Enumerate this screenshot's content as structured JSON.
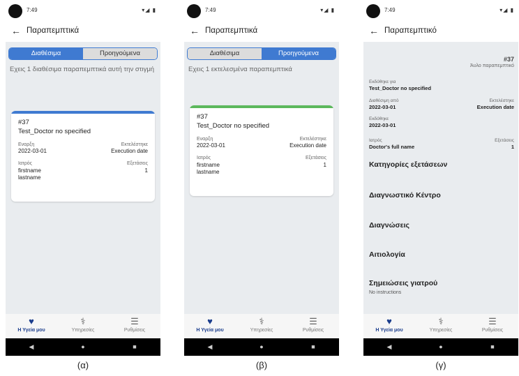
{
  "status": {
    "time": "7:49",
    "indicators": "◉ ▣",
    "signal": "▾◢ ▮"
  },
  "screens": [
    {
      "title": "Παραπεμπτικά",
      "tabs": [
        "Διαθέσιμα",
        "Προηγούμενα"
      ],
      "active_tab": 0,
      "info": "Εχεις 1 διαθέσιμα παραπεμπτικά αυτή την στιγμή",
      "card": {
        "number": "#37",
        "name": "Test_Doctor no specified",
        "start_label": "Εναρξη",
        "start_value": "2022-03-01",
        "executed_label": "Εκτελέστηκε",
        "executed_value": "Execution date",
        "doctor_label": "Ιατρός",
        "doctor_first": "firstname",
        "doctor_last": "lastname",
        "exams_label": "Εξετάσεις",
        "exams_value": "1",
        "accent": "#3f7ad1"
      }
    },
    {
      "title": "Παραπεμπτικά",
      "tabs": [
        "Διαθέσιμα",
        "Προηγούμενα"
      ],
      "active_tab": 1,
      "info": "Εχεις 1 εκτελεσμένα παραπεμπτικά",
      "card": {
        "number": "#37",
        "name": "Test_Doctor no specified",
        "start_label": "Εναρξη",
        "start_value": "2022-03-01",
        "executed_label": "Εκτελέστηκε",
        "executed_value": "Execution date",
        "doctor_label": "Ιατρός",
        "doctor_first": "firstname",
        "doctor_last": "lastname",
        "exams_label": "Εξετάσεις",
        "exams_value": "1",
        "accent": "#5cb85c"
      }
    },
    {
      "title": "Παραπεμπτικό",
      "number": "#37",
      "type": "Άυλο παραπεμπτικό",
      "issued_for_label": "Εκδόθηκε για",
      "issued_for_value": "Test_Doctor no specified",
      "available_from_label": "Διαθέσιμη από",
      "available_from_value": "2022-03-01",
      "executed_label": "Εκτελέστηκε",
      "executed_value": "Execution date",
      "issued_label": "Εκδόθηκε",
      "issued_value": "2022-03-01",
      "doctor_label": "Ιατρός",
      "doctor_value": "Doctor's full name",
      "exams_label": "Εξετάσεις",
      "exams_value": "1",
      "sections": [
        "Κατηγορίες εξετάσεων",
        "Διαγνωστικό Κέντρο",
        "Διαγνώσεις",
        "Αιτιολογία",
        "Σημειώσεις γιατρού"
      ],
      "notes": "No instructions"
    }
  ],
  "bottom_nav": [
    {
      "label": "Η Υγεία μου",
      "icon": "health-hand-icon",
      "glyph": "♥"
    },
    {
      "label": "Υπηρεσίες",
      "icon": "caduceus-icon",
      "glyph": "⚕"
    },
    {
      "label": "Ρυθμίσεις",
      "icon": "menu-icon",
      "glyph": "☰"
    }
  ],
  "system_nav": {
    "back": "◀",
    "home": "●",
    "recents": "■"
  },
  "captions": [
    "(α)",
    "(β)",
    "(γ)"
  ]
}
